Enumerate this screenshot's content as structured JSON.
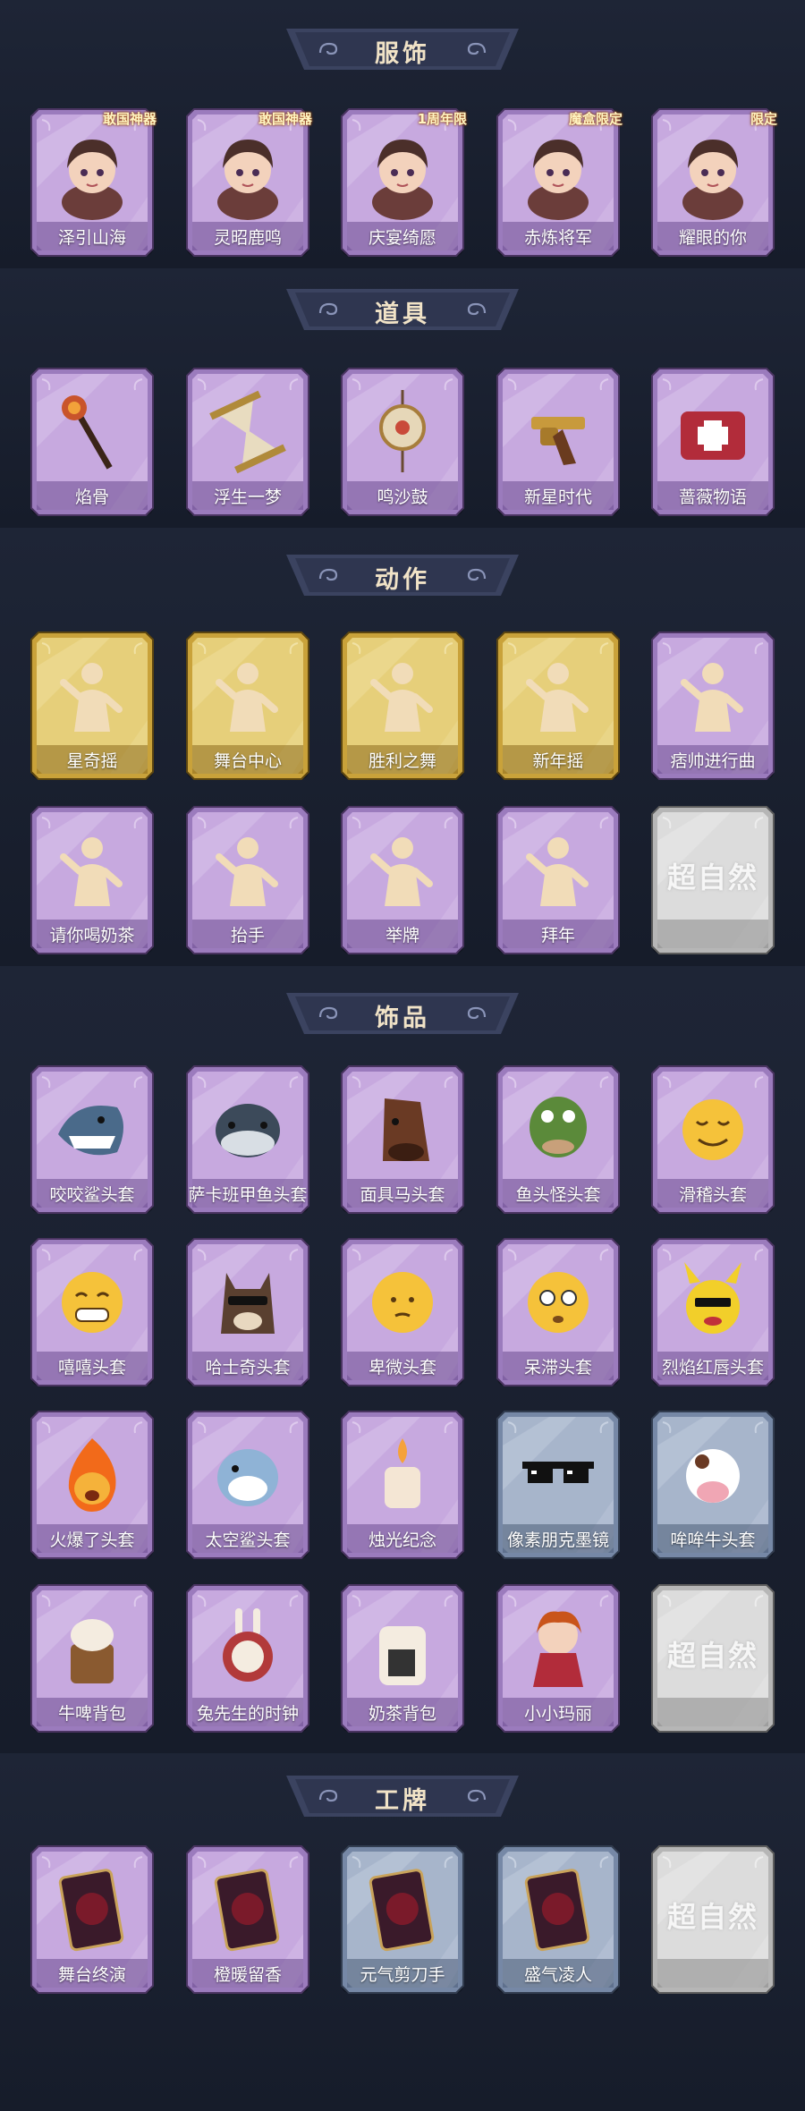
{
  "sections": [
    {
      "title": "服饰",
      "items": [
        {
          "label": "泽引山海",
          "style": "purple",
          "icon": "character-portrait-icon",
          "badge": "敢国神器"
        },
        {
          "label": "灵昭鹿鸣",
          "style": "purple",
          "icon": "character-portrait-icon",
          "badge": "敢国神器"
        },
        {
          "label": "庆宴绮愿",
          "style": "purple",
          "icon": "character-portrait-icon",
          "badge": "1周年限"
        },
        {
          "label": "赤炼将军",
          "style": "purple",
          "icon": "character-portrait-icon",
          "badge": "魔盒限定"
        },
        {
          "label": "耀眼的你",
          "style": "purple",
          "icon": "character-portrait-icon",
          "badge": "限定"
        }
      ]
    },
    {
      "title": "道具",
      "items": [
        {
          "label": "焰骨",
          "style": "purple",
          "icon": "scepter-icon"
        },
        {
          "label": "浮生一梦",
          "style": "purple",
          "icon": "hourglass-icon"
        },
        {
          "label": "鸣沙鼓",
          "style": "purple",
          "icon": "drum-icon"
        },
        {
          "label": "新星时代",
          "style": "purple",
          "icon": "revolver-icon"
        },
        {
          "label": "蔷薇物语",
          "style": "purple",
          "icon": "medkit-icon"
        }
      ]
    },
    {
      "title": "动作",
      "items": [
        {
          "label": "星奇摇",
          "style": "gold",
          "icon": "pose-icon"
        },
        {
          "label": "舞台中心",
          "style": "gold",
          "icon": "pose-icon"
        },
        {
          "label": "胜利之舞",
          "style": "gold",
          "icon": "pose-icon"
        },
        {
          "label": "新年摇",
          "style": "gold",
          "icon": "pose-icon"
        },
        {
          "label": "痞帅进行曲",
          "style": "purple",
          "icon": "pose-icon"
        },
        {
          "label": "请你喝奶茶",
          "style": "purple",
          "icon": "pose-icon"
        },
        {
          "label": "抬手",
          "style": "purple",
          "icon": "pose-icon"
        },
        {
          "label": "举牌",
          "style": "purple",
          "icon": "pose-icon"
        },
        {
          "label": "拜年",
          "style": "purple",
          "icon": "pose-icon"
        },
        {
          "label": "",
          "style": "silver",
          "icon": "brand-watermark-icon",
          "watermark": "超自然"
        }
      ]
    },
    {
      "title": "饰品",
      "items": [
        {
          "label": "咬咬鲨头套",
          "style": "purple",
          "icon": "shark-head-icon"
        },
        {
          "label": "萨卡班甲鱼头套",
          "style": "purple",
          "icon": "fish-head-icon"
        },
        {
          "label": "面具马头套",
          "style": "purple",
          "icon": "horse-head-icon"
        },
        {
          "label": "鱼头怪头套",
          "style": "purple",
          "icon": "fish-monster-icon"
        },
        {
          "label": "滑稽头套",
          "style": "purple",
          "icon": "funny-face-icon"
        },
        {
          "label": "嘻嘻头套",
          "style": "purple",
          "icon": "grin-face-icon"
        },
        {
          "label": "哈士奇头套",
          "style": "purple",
          "icon": "husky-head-icon"
        },
        {
          "label": "卑微头套",
          "style": "purple",
          "icon": "humble-face-icon"
        },
        {
          "label": "呆滞头套",
          "style": "purple",
          "icon": "dazed-face-icon"
        },
        {
          "label": "烈焰红唇头套",
          "style": "purple",
          "icon": "yellow-mascot-icon"
        },
        {
          "label": "火爆了头套",
          "style": "purple",
          "icon": "fire-face-icon"
        },
        {
          "label": "太空鲨头套",
          "style": "purple",
          "icon": "space-shark-icon"
        },
        {
          "label": "烛光纪念",
          "style": "purple",
          "icon": "candle-icon"
        },
        {
          "label": "像素朋克墨镜",
          "style": "blue",
          "icon": "pixel-sunglasses-icon"
        },
        {
          "label": "哞哞牛头套",
          "style": "blue",
          "icon": "cow-head-icon"
        },
        {
          "label": "牛啤背包",
          "style": "purple",
          "icon": "cow-backpack-icon"
        },
        {
          "label": "兔先生的时钟",
          "style": "purple",
          "icon": "rabbit-clock-icon"
        },
        {
          "label": "奶茶背包",
          "style": "purple",
          "icon": "milktea-backpack-icon"
        },
        {
          "label": "小小玛丽",
          "style": "purple",
          "icon": "doll-icon"
        },
        {
          "label": "",
          "style": "silver",
          "icon": "brand-watermark-icon",
          "watermark": "超自然"
        }
      ]
    },
    {
      "title": "工牌",
      "items": [
        {
          "label": "舞台终演",
          "style": "purple",
          "icon": "badge-card-icon"
        },
        {
          "label": "橙暖留香",
          "style": "purple",
          "icon": "badge-card-icon"
        },
        {
          "label": "元气剪刀手",
          "style": "blue",
          "icon": "badge-card-icon"
        },
        {
          "label": "盛气凌人",
          "style": "blue",
          "icon": "badge-card-icon"
        },
        {
          "label": "",
          "style": "silver",
          "icon": "brand-watermark-icon",
          "watermark": "超自然"
        }
      ]
    }
  ],
  "colors": {
    "purple": "#a783c7",
    "gold": "#d8b74c",
    "silver": "#cfcfcf",
    "blue": "#8096b4",
    "header": "#3b4360"
  }
}
